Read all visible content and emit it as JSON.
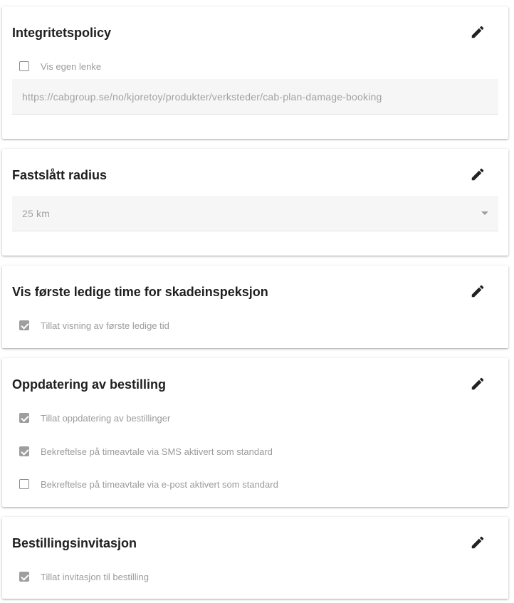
{
  "sections": {
    "privacy": {
      "title": "Integritetspolicy",
      "checkbox_label": "Vis egen lenke",
      "checked": false,
      "url_value": "https://cabgroup.se/no/kjoretoy/produkter/verksteder/cab-plan-damage-booking"
    },
    "radius": {
      "title": "Fastslått radius",
      "selected_value": "25 km"
    },
    "first_available": {
      "title": "Vis første ledige time for skadeinspeksjon",
      "checkbox_label": "Tillat visning av første ledige tid",
      "checked": true
    },
    "booking_update": {
      "title": "Oppdatering av bestilling",
      "options": [
        {
          "label": "Tillat oppdatering av bestillinger",
          "checked": true
        },
        {
          "label": "Bekreftelse på timeavtale via SMS aktivert som standard",
          "checked": true
        },
        {
          "label": "Bekreftelse på timeavtale via e-post aktivert som standard",
          "checked": false
        }
      ]
    },
    "invitation": {
      "title": "Bestillingsinvitasjon",
      "checkbox_label": "Tillat invitasjon til bestilling",
      "checked": true
    }
  },
  "icons": {
    "edit": "pencil-icon",
    "dropdown": "caret-down-icon"
  },
  "colors": {
    "title_text": "#1f1f1f",
    "muted_text": "#9b9b9b",
    "field_bg": "#f6f6f6",
    "checkbox_checked": "#9e9e9e"
  }
}
